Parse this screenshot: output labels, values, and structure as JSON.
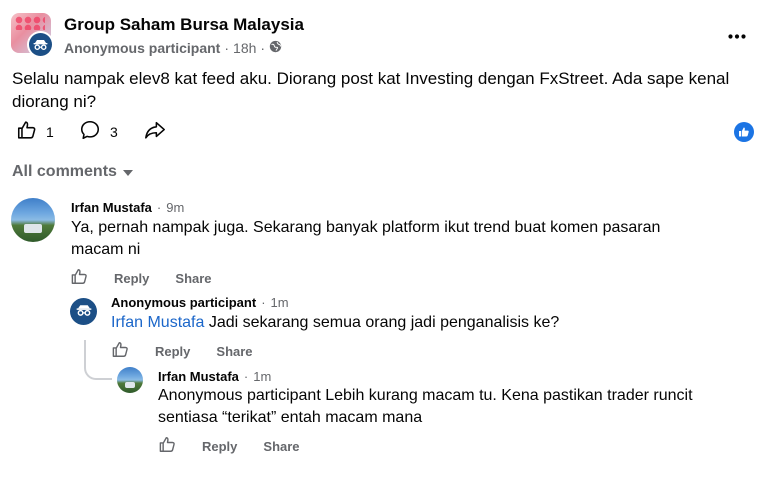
{
  "post": {
    "group_name": "Group Saham Bursa Malaysia",
    "author": "Anonymous participant",
    "time": "18h",
    "separator": "·",
    "text": "Selalu nampak elev8 kat feed aku. Diorang post kat Investing dengan FxStreet. Ada sape kenal diorang ni?",
    "like_count": "1",
    "comment_count": "3"
  },
  "comments_header": "All comments",
  "labels": {
    "reply": "Reply",
    "share": "Share"
  },
  "comments": [
    {
      "name": "Irfan Mustafa",
      "time": "9m",
      "text": "Ya, pernah nampak juga. Sekarang banyak platform ikut trend buat komen pasaran macam ni"
    },
    {
      "name": "Anonymous participant",
      "time": "1m",
      "mention": "Irfan Mustafa",
      "text": "Jadi sekarang semua orang jadi penganalisis ke?"
    },
    {
      "name": "Irfan Mustafa",
      "time": "1m",
      "text": "Anonymous participant Lebih kurang macam tu. Kena pastikan trader runcit sentiasa “terikat” entah macam mana"
    }
  ],
  "colors": {
    "accent": "#1b74e4",
    "anon": "#1c4f86",
    "secondary_text": "#65676b",
    "mention": "#1b66c9"
  },
  "icons": [
    "more-icon",
    "globe-icon",
    "like-icon",
    "comment-icon",
    "share-icon",
    "like-badge-icon",
    "caret-down-icon",
    "anonymous-icon"
  ]
}
